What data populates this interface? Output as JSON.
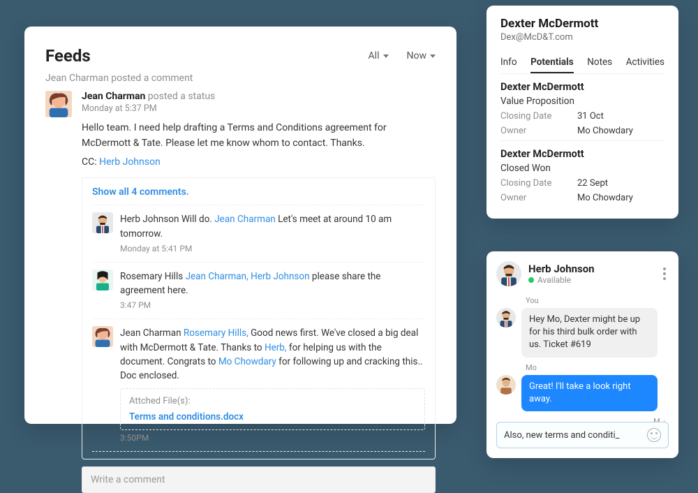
{
  "feeds": {
    "title": "Feeds",
    "filter_all": "All",
    "filter_now": "Now",
    "subline": "Jean Charman posted a comment",
    "post": {
      "author": "Jean Charman",
      "verb": "posted a status",
      "time": "Monday at 5:37 PM",
      "message": "Hello team. I need help drafting a Terms and Conditions agreement for McDermott & Tate. Please let me know whom to contact. Thanks.",
      "cc_label": "CC:",
      "cc_name": "Herb Johnson"
    },
    "thread_toggle": "Show all 4 comments.",
    "comments": [
      {
        "author": "Herb Johnson",
        "text_a": " Will do. ",
        "mention_a": "Jean Charman",
        "text_b": " Let's meet at around 10 am tomorrow.",
        "time": "Monday at 5:41 PM"
      },
      {
        "author": "Rosemary Hills",
        "mention_a": "Jean Charman, Herb Johnson",
        "text_b": " please share the agreement here.",
        "time": "3:47 PM"
      },
      {
        "author": "Jean Charman",
        "mention_a": "Rosemary Hills,",
        "text_a": " Good news first. We've closed a big deal with McDermott & Tate. Thanks to ",
        "mention_b": "Herb,",
        "text_b": " for helping us with the document. Congrats to ",
        "mention_c": "Mo Chowdary",
        "text_c": "  for following up and cracking this.. Doc enclosed.",
        "att_label": "Attched File(s):",
        "att_file": "Terms and conditions.docx",
        "time": "3:50PM"
      }
    ],
    "write_placeholder": "Write a comment"
  },
  "contact": {
    "name": "Dexter McDermott",
    "email": "Dex@McD&T.com",
    "tabs": [
      "Info",
      "Potentials",
      "Notes",
      "Activities"
    ],
    "active_tab": "Potentials",
    "potentials": [
      {
        "title": "Dexter McDermott",
        "stage": "Value Proposition",
        "closing_label": "Closing Date",
        "closing": "31 Oct",
        "owner_label": "Owner",
        "owner": "Mo Chowdary"
      },
      {
        "title": "Dexter McDermott",
        "stage": "Closed Won",
        "closing_label": "Closing Date",
        "closing": "22 Sept",
        "owner_label": "Owner",
        "owner": "Mo Chowdary"
      }
    ]
  },
  "chat": {
    "title": "Herb Johnson",
    "status": "Available",
    "you_label": "You",
    "mo_label": "Mo",
    "msg_in": "Hey Mo, Dexter might be up for his third bulk order with us. Ticket #619",
    "msg_out": "Great! I'll take a look right away.",
    "md_indicator": "M ↓",
    "input_value": "Also, new terms and conditi_"
  }
}
